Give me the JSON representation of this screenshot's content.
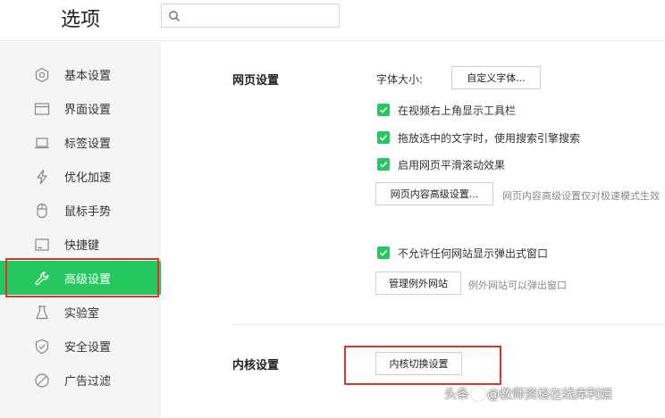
{
  "header": {
    "title": "选项",
    "search_placeholder": "",
    "search_value": ""
  },
  "sidebar": {
    "items": [
      {
        "label": "基本设置",
        "icon": "gear-icon"
      },
      {
        "label": "界面设置",
        "icon": "window-icon"
      },
      {
        "label": "标签设置",
        "icon": "tab-icon"
      },
      {
        "label": "优化加速",
        "icon": "lightning-icon"
      },
      {
        "label": "鼠标手势",
        "icon": "mouse-icon"
      },
      {
        "label": "快捷键",
        "icon": "keyboard-icon"
      },
      {
        "label": "高级设置",
        "icon": "wrench-icon",
        "active": true
      },
      {
        "label": "实验室",
        "icon": "flask-icon"
      },
      {
        "label": "安全设置",
        "icon": "shield-icon"
      },
      {
        "label": "广告过滤",
        "icon": "block-icon"
      }
    ]
  },
  "colors": {
    "accent": "#24c85f",
    "highlight_outline": "#e0322e",
    "sidebar_bg": "#f5f5f5"
  },
  "webpage": {
    "title": "网页设置",
    "font_size_label": "字体大小:",
    "custom_font_button": "自定义字体...",
    "options": [
      {
        "label": "在视频右上角显示工具栏",
        "checked": true
      },
      {
        "label": "拖放选中的文字时，使用搜索引擎搜索",
        "checked": true
      },
      {
        "label": "启用网页平滑滚动效果",
        "checked": true
      }
    ],
    "advanced_button": "网页内容高级设置...",
    "advanced_hint": "网页内容高级设置仅对极速模式生效",
    "popup_option": {
      "label": "不允许任何网站显示弹出式窗口",
      "checked": true
    },
    "exceptions_button": "管理例外网站",
    "exceptions_hint": "例外网站可以弹出窗口"
  },
  "kernel": {
    "title": "内核设置",
    "switch_button": "内核切换设置"
  },
  "watermark": {
    "prefix": "头条",
    "suffix": "@教师资格在线库利姐"
  }
}
